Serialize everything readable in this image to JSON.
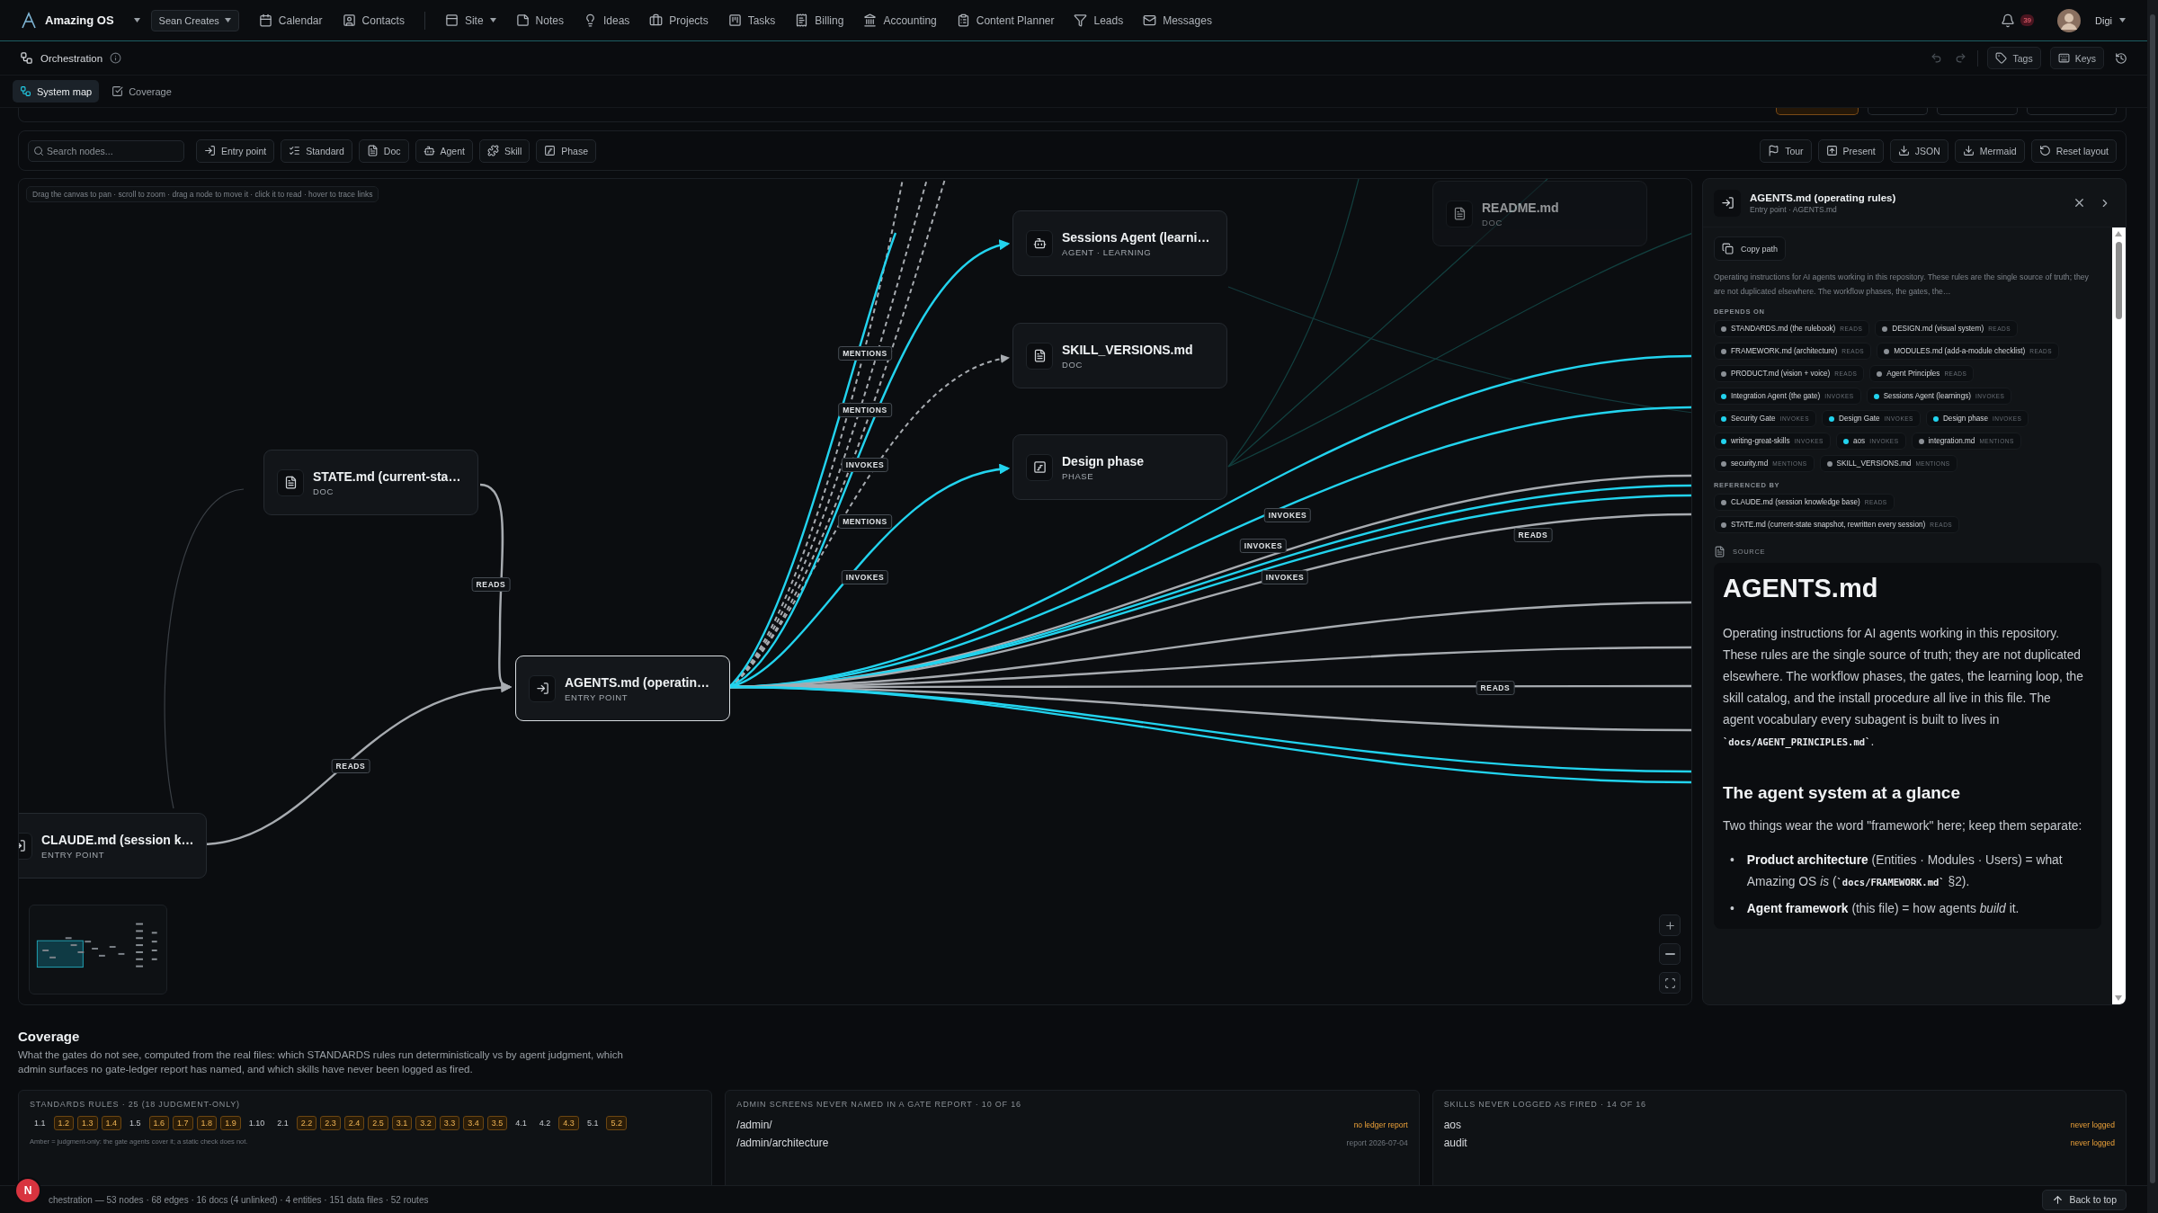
{
  "top_nav": {
    "app_name": "Amazing OS",
    "workspace": "Sean Creates",
    "items": [
      {
        "label": "Calendar",
        "has_menu": false
      },
      {
        "label": "Contacts",
        "has_menu": false
      },
      {
        "label": "Site",
        "has_menu": true
      },
      {
        "label": "Notes",
        "has_menu": false
      },
      {
        "label": "Ideas",
        "has_menu": false
      },
      {
        "label": "Projects",
        "has_menu": false
      },
      {
        "label": "Tasks",
        "has_menu": false
      },
      {
        "label": "Billing",
        "has_menu": false
      },
      {
        "label": "Accounting",
        "has_menu": false
      },
      {
        "label": "Content Planner",
        "has_menu": false
      },
      {
        "label": "Leads",
        "has_menu": false
      },
      {
        "label": "Messages",
        "has_menu": false
      }
    ],
    "notifications": "39",
    "user": "Digi"
  },
  "page_header": {
    "title": "Orchestration",
    "actions": [
      "Tags",
      "Keys"
    ]
  },
  "tabs": [
    {
      "label": "System map",
      "selected": true
    },
    {
      "label": "Coverage",
      "selected": false
    }
  ],
  "toolbar": {
    "search": {
      "placeholder": "Search nodes..."
    },
    "filters": [
      {
        "label": "Entry point",
        "kind": "entry"
      },
      {
        "label": "Standard",
        "kind": "standard"
      },
      {
        "label": "Doc",
        "kind": "doc"
      },
      {
        "label": "Agent",
        "kind": "agent"
      },
      {
        "label": "Skill",
        "kind": "skill"
      },
      {
        "label": "Phase",
        "kind": "phase"
      }
    ],
    "actions": [
      "Tour",
      "Present",
      "JSON",
      "Mermaid",
      "Reset layout"
    ]
  },
  "canvas": {
    "hint": "Drag the canvas to pan · scroll to zoom · drag a node to move it · click it to read · hover to trace links",
    "nodes": [
      {
        "title": "Sessions Agent (learni…",
        "subtitle": "AGENT · LEARNING",
        "kind": "agent",
        "selected": false,
        "dimmed": false
      },
      {
        "title": "SKILL_VERSIONS.md",
        "subtitle": "DOC",
        "kind": "doc",
        "selected": false,
        "dimmed": false
      },
      {
        "title": "Design phase",
        "subtitle": "PHASE",
        "kind": "phase",
        "selected": false,
        "dimmed": false
      },
      {
        "title": "STATE.md (current-sta…",
        "subtitle": "DOC",
        "kind": "doc",
        "selected": false,
        "dimmed": false
      },
      {
        "title": "AGENTS.md (operatin…",
        "subtitle": "ENTRY POINT",
        "kind": "entry",
        "selected": true,
        "dimmed": false
      },
      {
        "title": "CLAUDE.md (session k…",
        "subtitle": "ENTRY POINT",
        "kind": "entry",
        "selected": false,
        "dimmed": false
      },
      {
        "title": "README.md",
        "subtitle": "DOC",
        "kind": "doc",
        "selected": false,
        "dimmed": true
      }
    ],
    "edge_labels": [
      "MENTIONS",
      "MENTIONS",
      "INVOKES",
      "MENTIONS",
      "INVOKES",
      "READS",
      "READS",
      "INVOKES",
      "INVOKES",
      "INVOKES",
      "READS",
      "READS"
    ]
  },
  "detail_panel": {
    "title": "AGENTS.md (operating rules)",
    "subtitle": "Entry point · AGENTS.md",
    "copy_button": "Copy path",
    "summary": "Operating instructions for AI agents working in this repository. These rules are the single source of truth; they are not duplicated elsewhere. The workflow phases, the gates, the…",
    "depends_on_label": "DEPENDS ON",
    "depends_on": [
      {
        "name": "STANDARDS.md (the rulebook)",
        "relation": "READS",
        "color": "#8b9096"
      },
      {
        "name": "DESIGN.md (visual system)",
        "relation": "READS",
        "color": "#8b9096"
      },
      {
        "name": "FRAMEWORK.md (architecture)",
        "relation": "READS",
        "color": "#8b9096"
      },
      {
        "name": "MODULES.md (add-a-module checklist)",
        "relation": "READS",
        "color": "#8b9096"
      },
      {
        "name": "PRODUCT.md (vision + voice)",
        "relation": "READS",
        "color": "#8b9096"
      },
      {
        "name": "Agent Principles",
        "relation": "READS",
        "color": "#8b9096"
      },
      {
        "name": "Integration Agent (the gate)",
        "relation": "INVOKES",
        "color": "#22d3ee"
      },
      {
        "name": "Sessions Agent (learnings)",
        "relation": "INVOKES",
        "color": "#22d3ee"
      },
      {
        "name": "Security Gate",
        "relation": "INVOKES",
        "color": "#22d3ee"
      },
      {
        "name": "Design Gate",
        "relation": "INVOKES",
        "color": "#22d3ee"
      },
      {
        "name": "Design phase",
        "relation": "INVOKES",
        "color": "#22d3ee"
      },
      {
        "name": "writing-great-skills",
        "relation": "INVOKES",
        "color": "#22d3ee"
      },
      {
        "name": "aos",
        "relation": "INVOKES",
        "color": "#22d3ee"
      },
      {
        "name": "integration.md",
        "relation": "MENTIONS",
        "color": "#8b9096"
      },
      {
        "name": "security.md",
        "relation": "MENTIONS",
        "color": "#8b9096"
      },
      {
        "name": "SKILL_VERSIONS.md",
        "relation": "MENTIONS",
        "color": "#8b9096"
      }
    ],
    "referenced_by_label": "REFERENCED BY",
    "referenced_by": [
      {
        "name": "CLAUDE.md (session knowledge base)",
        "relation": "READS",
        "color": "#8b9096"
      },
      {
        "name": "STATE.md (current-state snapshot, rewritten every session)",
        "relation": "READS",
        "color": "#8b9096"
      }
    ],
    "source_label": "SOURCE",
    "source": {
      "heading": "AGENTS.md",
      "blocks": [
        {
          "kind": "paragraph",
          "segments": [
            {
              "kind": "plain",
              "text": "Operating instructions for AI agents working in this repository. These rules are the single source of truth; they are not duplicated elsewhere. The workflow phases, the gates, the learning loop, the skill catalog, and the install procedure all live in this file. The agent vocabulary every subagent is built to lives in "
            },
            {
              "kind": "code",
              "text": "`docs/AGENT_PRINCIPLES.md`"
            },
            {
              "kind": "plain",
              "text": "."
            }
          ]
        },
        {
          "kind": "heading",
          "text": "The agent system at a glance"
        },
        {
          "kind": "paragraph",
          "segments": [
            {
              "kind": "plain",
              "text": "Two things wear the word \"framework\" here; keep them separate:"
            }
          ]
        },
        {
          "kind": "list",
          "items": [
            {
              "marker": "•",
              "segments": [
                {
                  "kind": "bold",
                  "text": "Product architecture"
                },
                {
                  "kind": "plain",
                  "text": " (Entities · Modules · Users) = what Amazing OS "
                },
                {
                  "kind": "italic",
                  "text": "is"
                },
                {
                  "kind": "plain",
                  "text": " ("
                },
                {
                  "kind": "code",
                  "text": "`docs/FRAMEWORK.md`"
                },
                {
                  "kind": "plain",
                  "text": " §2)."
                }
              ]
            },
            {
              "marker": "•",
              "segments": [
                {
                  "kind": "bold",
                  "text": "Agent framework"
                },
                {
                  "kind": "plain",
                  "text": " (this file) = how agents "
                },
                {
                  "kind": "italic",
                  "text": "build"
                },
                {
                  "kind": "plain",
                  "text": " it."
                }
              ]
            }
          ]
        }
      ]
    }
  },
  "coverage": {
    "title": "Coverage",
    "description": "What the gates do not see, computed from the real files: which STANDARDS rules run deterministically vs by agent judgment, which admin surfaces no gate-ledger report has named, and which skills have never been logged as fired.",
    "standards": {
      "title": "STANDARDS RULES · 25 (18 JUDGMENT-ONLY)",
      "rules": [
        {
          "label": "1.1",
          "judgment_only": false
        },
        {
          "label": "1.2",
          "judgment_only": true
        },
        {
          "label": "1.3",
          "judgment_only": true
        },
        {
          "label": "1.4",
          "judgment_only": true
        },
        {
          "label": "1.5",
          "judgment_only": false
        },
        {
          "label": "1.6",
          "judgment_only": true
        },
        {
          "label": "1.7",
          "judgment_only": true
        },
        {
          "label": "1.8",
          "judgment_only": true
        },
        {
          "label": "1.9",
          "judgment_only": true
        },
        {
          "label": "1.10",
          "judgment_only": false
        },
        {
          "label": "2.1",
          "judgment_only": false
        },
        {
          "label": "2.2",
          "judgment_only": true
        },
        {
          "label": "2.3",
          "judgment_only": true
        },
        {
          "label": "2.4",
          "judgment_only": true
        },
        {
          "label": "2.5",
          "judgment_only": true
        },
        {
          "label": "3.1",
          "judgment_only": true
        },
        {
          "label": "3.2",
          "judgment_only": true
        },
        {
          "label": "3.3",
          "judgment_only": true
        },
        {
          "label": "3.4",
          "judgment_only": true
        },
        {
          "label": "3.5",
          "judgment_only": true
        },
        {
          "label": "4.1",
          "judgment_only": false
        },
        {
          "label": "4.2",
          "judgment_only": false
        },
        {
          "label": "4.3",
          "judgment_only": true
        },
        {
          "label": "5.1",
          "judgment_only": false
        },
        {
          "label": "5.2",
          "judgment_only": true
        }
      ],
      "legend": "Amber = judgment-only: the gate agents cover it; a static check does not."
    },
    "admin_screens": {
      "title": "ADMIN SCREENS NEVER NAMED IN A GATE REPORT · 10 OF 16",
      "rows": [
        {
          "path": "/admin/",
          "status": "no ledger report",
          "flagged": true
        },
        {
          "path": "/admin/architecture",
          "status": "report 2026-07-04",
          "flagged": false
        }
      ]
    },
    "skills": {
      "title": "SKILLS NEVER LOGGED AS FIRED · 14 OF 16",
      "rows": [
        {
          "name": "aos",
          "status": "never logged",
          "flagged": true
        },
        {
          "name": "audit",
          "status": "never logged",
          "flagged": true
        }
      ]
    }
  },
  "status_bar": {
    "summary": "chestration — 53 nodes · 68 edges · 16 docs (4 unlinked) · 4 entities · 151 data files · 52 routes",
    "back_to_top": "Back to top",
    "dev_badge": "N"
  }
}
